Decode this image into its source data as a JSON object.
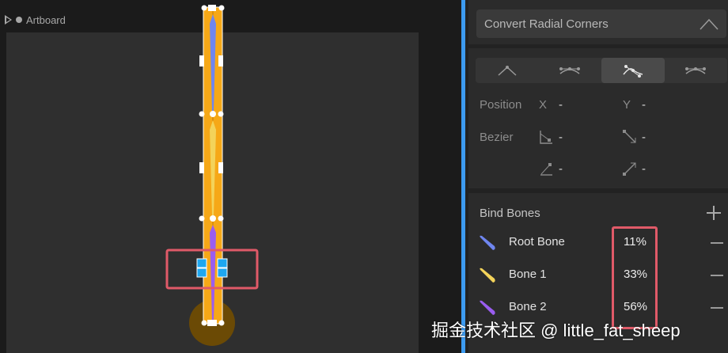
{
  "canvas": {
    "artboard_label": "Artboard"
  },
  "panel": {
    "convert_label": "Convert Radial Corners",
    "vertex_modes": [
      "straight-icon",
      "mirrored-icon",
      "detached-icon",
      "asymmetric-icon"
    ],
    "position_label": "Position",
    "x_label": "X",
    "x_value": "-",
    "y_label": "Y",
    "y_value": "-",
    "bezier_label": "Bezier",
    "bezier_in_value": "-",
    "bezier_out_value": "-",
    "bezier_in2_value": "-",
    "bezier_out2_value": "-",
    "bind_bones_title": "Bind Bones",
    "bones": [
      {
        "name": "Root Bone",
        "percent": "11%",
        "color": "#6f86f0"
      },
      {
        "name": "Bone 1",
        "percent": "33%",
        "color": "#f3d35a"
      },
      {
        "name": "Bone 2",
        "percent": "56%",
        "color": "#9a5df0"
      }
    ]
  },
  "colors": {
    "accent_divider": "#3d9bf0",
    "bone_fill": "#f6a817",
    "highlight": "#e05a68",
    "selected_vertex": "#1ea7f0"
  },
  "watermark": "掘金技术社区 @ little_fat_sheep"
}
